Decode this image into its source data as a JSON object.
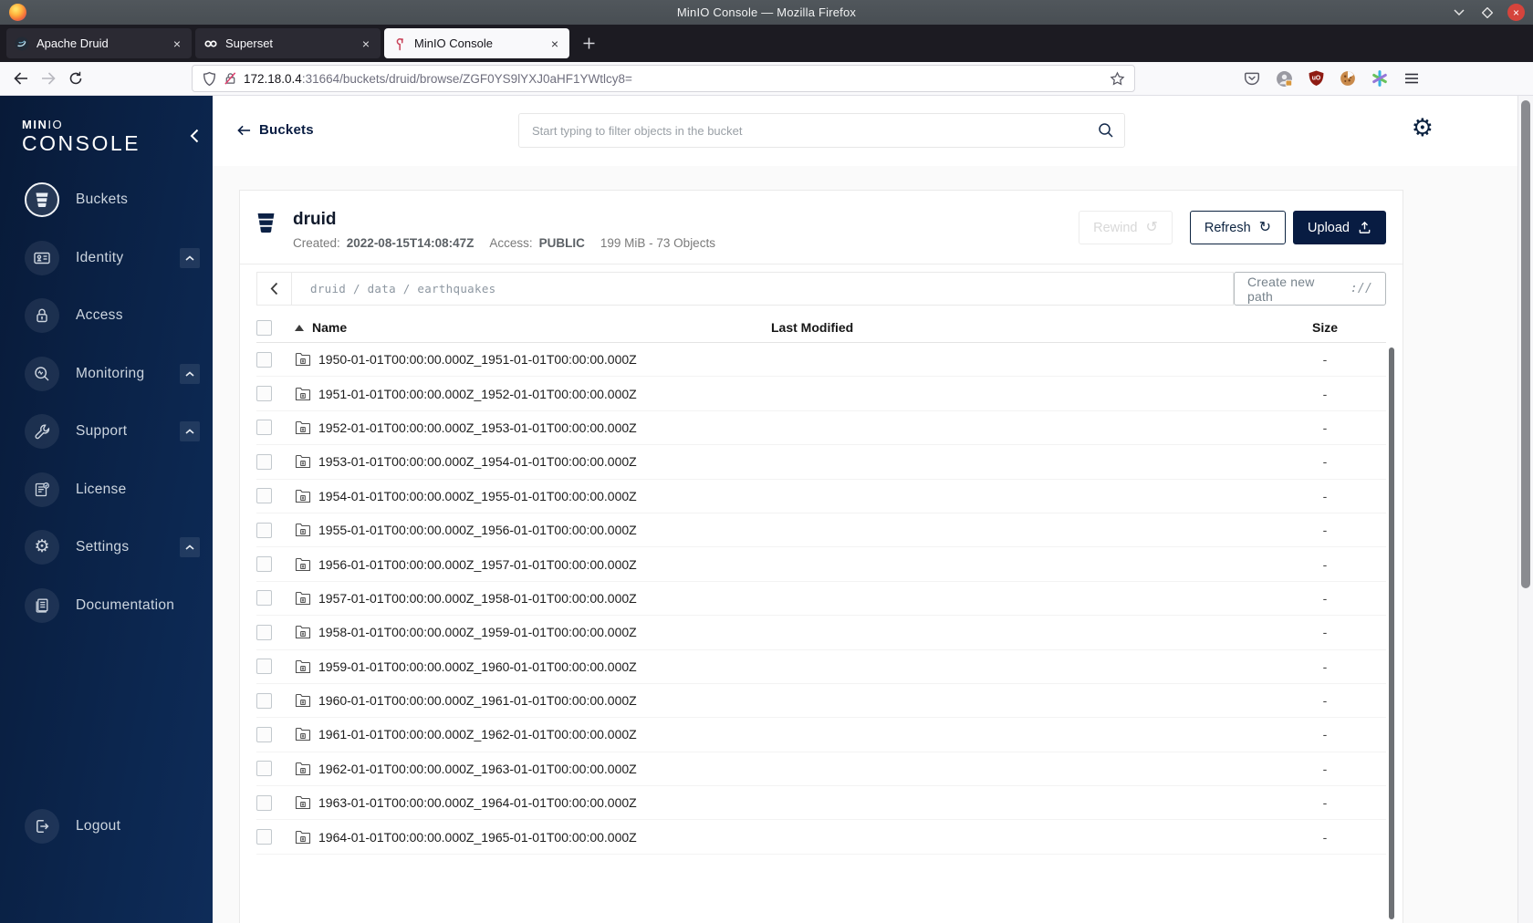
{
  "browser": {
    "window_title": "MinIO Console — Mozilla Firefox",
    "tabs": [
      {
        "title": "Apache Druid",
        "icon": "druid-favicon",
        "active": false
      },
      {
        "title": "Superset",
        "icon": "superset-favicon",
        "active": false
      },
      {
        "title": "MinIO Console",
        "icon": "minio-favicon",
        "active": true
      }
    ],
    "url": {
      "host": "172.18.0.4",
      "rest": ":31664/buckets/druid/browse/ZGF0YS9lYXJ0aHF1YWtlcy8="
    }
  },
  "sidebar": {
    "logo": {
      "min": "MIN",
      "io": "IO",
      "console": "CONSOLE"
    },
    "items": [
      {
        "label": "Buckets",
        "icon": "bucket-icon",
        "selected": true,
        "expandable": false
      },
      {
        "label": "Identity",
        "icon": "identity-card-icon",
        "selected": false,
        "expandable": true
      },
      {
        "label": "Access",
        "icon": "lock-icon",
        "selected": false,
        "expandable": false
      },
      {
        "label": "Monitoring",
        "icon": "monitoring-search-icon",
        "selected": false,
        "expandable": true
      },
      {
        "label": "Support",
        "icon": "support-wrench-icon",
        "selected": false,
        "expandable": true
      },
      {
        "label": "License",
        "icon": "license-icon",
        "selected": false,
        "expandable": false
      },
      {
        "label": "Settings",
        "icon": "settings-gear-icon",
        "selected": false,
        "expandable": true
      },
      {
        "label": "Documentation",
        "icon": "documentation-icon",
        "selected": false,
        "expandable": false
      }
    ],
    "logout": {
      "label": "Logout",
      "icon": "logout-icon"
    }
  },
  "content": {
    "back_label": "Buckets",
    "search_placeholder": "Start typing to filter objects in the bucket",
    "bucket": {
      "name": "druid",
      "created_label": "Created:",
      "created": "2022-08-15T14:08:47Z",
      "access_label": "Access:",
      "access": "PUBLIC",
      "size_summary": "199 MiB - 73 Objects",
      "rewind_label": "Rewind",
      "refresh_label": "Refresh",
      "upload_label": "Upload"
    },
    "browse": {
      "path": "druid / data / earthquakes",
      "create_path_label": "Create new path"
    },
    "table": {
      "name_header": "Name",
      "modified_header": "Last Modified",
      "size_header": "Size",
      "rows": [
        {
          "name": "1950-01-01T00:00:00.000Z_1951-01-01T00:00:00.000Z",
          "size": "-"
        },
        {
          "name": "1951-01-01T00:00:00.000Z_1952-01-01T00:00:00.000Z",
          "size": "-"
        },
        {
          "name": "1952-01-01T00:00:00.000Z_1953-01-01T00:00:00.000Z",
          "size": "-"
        },
        {
          "name": "1953-01-01T00:00:00.000Z_1954-01-01T00:00:00.000Z",
          "size": "-"
        },
        {
          "name": "1954-01-01T00:00:00.000Z_1955-01-01T00:00:00.000Z",
          "size": "-"
        },
        {
          "name": "1955-01-01T00:00:00.000Z_1956-01-01T00:00:00.000Z",
          "size": "-"
        },
        {
          "name": "1956-01-01T00:00:00.000Z_1957-01-01T00:00:00.000Z",
          "size": "-"
        },
        {
          "name": "1957-01-01T00:00:00.000Z_1958-01-01T00:00:00.000Z",
          "size": "-"
        },
        {
          "name": "1958-01-01T00:00:00.000Z_1959-01-01T00:00:00.000Z",
          "size": "-"
        },
        {
          "name": "1959-01-01T00:00:00.000Z_1960-01-01T00:00:00.000Z",
          "size": "-"
        },
        {
          "name": "1960-01-01T00:00:00.000Z_1961-01-01T00:00:00.000Z",
          "size": "-"
        },
        {
          "name": "1961-01-01T00:00:00.000Z_1962-01-01T00:00:00.000Z",
          "size": "-"
        },
        {
          "name": "1962-01-01T00:00:00.000Z_1963-01-01T00:00:00.000Z",
          "size": "-"
        },
        {
          "name": "1963-01-01T00:00:00.000Z_1964-01-01T00:00:00.000Z",
          "size": "-"
        },
        {
          "name": "1964-01-01T00:00:00.000Z_1965-01-01T00:00:00.000Z",
          "size": "-"
        }
      ]
    }
  }
}
